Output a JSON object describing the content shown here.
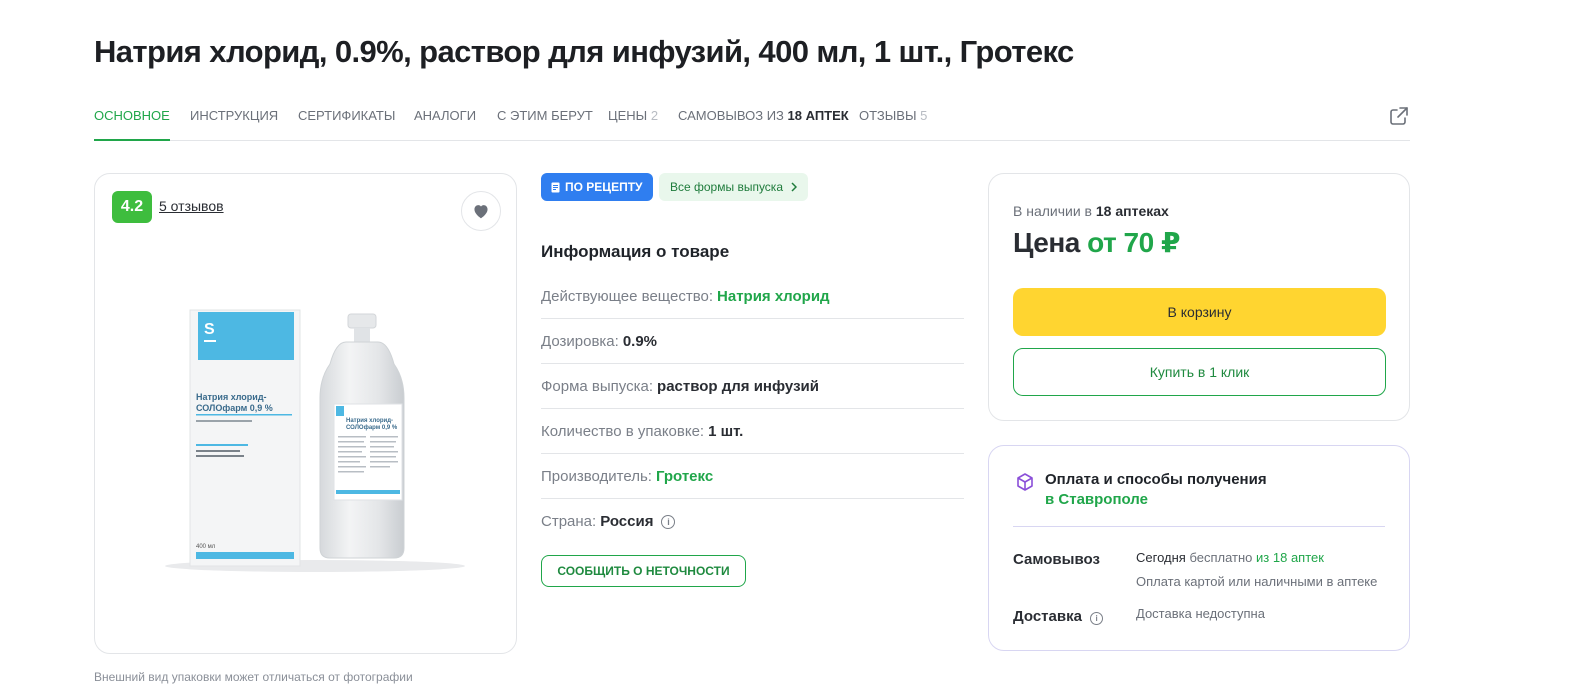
{
  "product": {
    "title": "Натрия хлорид, 0.9%, раствор для инфузий, 400 мл, 1 шт., Гротекс"
  },
  "tabs": [
    {
      "label": "Основное",
      "active": true
    },
    {
      "label": "Инструкция"
    },
    {
      "label": "Сертификаты"
    },
    {
      "label": "Аналоги"
    },
    {
      "label": "С этим берут"
    },
    {
      "label": "Цены",
      "count": "2"
    },
    {
      "label_prefix": "Самовывоз из",
      "label_bold": "18 аптек"
    },
    {
      "label": "Отзывы",
      "count": "5"
    }
  ],
  "share_icon": "external-link-icon",
  "image_card": {
    "rating": "4.2",
    "reviews_link": "5 отзывов",
    "favorite_icon": "heart-icon",
    "note": "Внешний вид упаковки может отличаться от фотографии",
    "pack_brand_letter": "S",
    "pack_name_line1": "Натрия хлорид-",
    "pack_name_line2": "СОЛОфарм 0,9 %",
    "pack_volume": "400 мл",
    "bottle_name_line1": "Натрия хлорид-",
    "bottle_name_line2": "СОЛОфарм 0,9 %"
  },
  "badges": {
    "rx": "По рецепту",
    "rx_icon": "prescription-icon",
    "forms": "Все формы выпуска",
    "forms_icon": "chevron-right-icon"
  },
  "info": {
    "title": "Информация о товаре",
    "rows": [
      {
        "label": "Действующее вещество:",
        "value": "Натрия хлорид",
        "link": true
      },
      {
        "label": "Дозировка:",
        "value": "0.9%"
      },
      {
        "label": "Форма выпуска:",
        "value": "раствор для инфузий"
      },
      {
        "label": "Количество в упаковке:",
        "value": "1 шт."
      },
      {
        "label": "Производитель:",
        "value": "Гротекс",
        "link": true
      },
      {
        "label": "Страна:",
        "value": "Россия",
        "info_icon": true
      }
    ],
    "report_button": "Сообщить о неточности"
  },
  "price_card": {
    "availability_prefix": "В наличии в",
    "availability_bold": "18 аптеках",
    "price_label": "Цена",
    "price_value": "от 70 ₽",
    "cart_button": "В корзину",
    "oneclick_button": "Купить в 1 клик"
  },
  "delivery": {
    "icon": "box-icon",
    "title": "Оплата и способы получения",
    "city": "в Ставрополе",
    "pickup_label": "Самовывоз",
    "pickup_today": "Сегодня",
    "pickup_free": "бесплатно",
    "pickup_stores": "из 18 аптек",
    "pickup_payment": "Оплата картой или наличными в аптеке",
    "delivery_label": "Доставка",
    "delivery_value": "Доставка недоступна"
  },
  "colors": {
    "accent_green": "#20a64a",
    "rating_green": "#3ebd3e",
    "rx_blue": "#2f7ef0",
    "cart_yellow": "#ffd530"
  }
}
